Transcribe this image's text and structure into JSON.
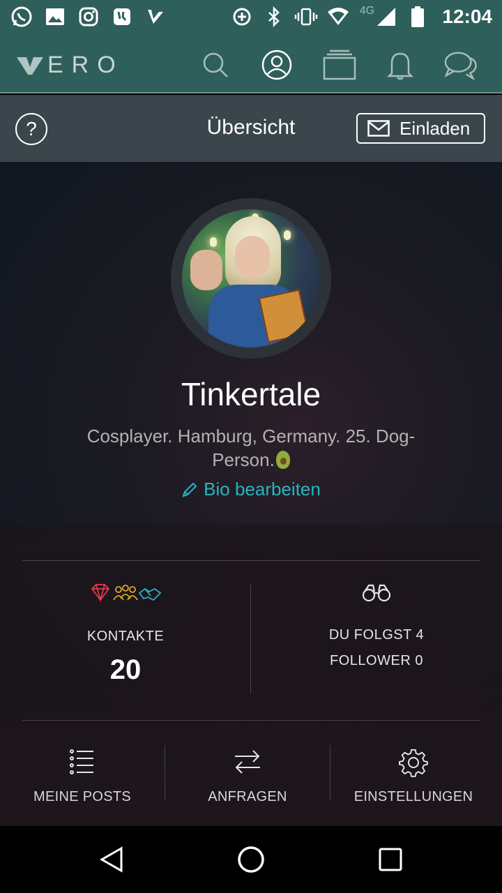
{
  "status_bar": {
    "time": "12:04",
    "network": "4G",
    "icons": [
      "whatsapp-icon",
      "gallery-icon",
      "instagram-icon",
      "tinder-like-icon",
      "check-icon",
      "data-saver-icon",
      "bluetooth-icon",
      "vibrate-icon",
      "wifi-icon",
      "signal-icon",
      "battery-icon"
    ]
  },
  "nav": {
    "logo": "ERO",
    "icons": [
      "search-icon",
      "profile-icon",
      "collections-icon",
      "notifications-icon",
      "chat-icon"
    ],
    "active": "profile-icon"
  },
  "header": {
    "title": "Übersicht",
    "help_label": "?",
    "invite_label": "Einladen"
  },
  "profile": {
    "name": "Tinkertale",
    "bio_line1": "Cosplayer. Hamburg, Germany. 25. Dog-",
    "bio_line2": "Person.",
    "edit_bio": "Bio bearbeiten"
  },
  "stats": {
    "contacts_label": "KONTAKTE",
    "contacts_value": "20",
    "following_label": "DU FOLGST 4",
    "followers_label": "FOLLOWER 0"
  },
  "bottom": {
    "posts": "MEINE POSTS",
    "requests": "ANFRAGEN",
    "settings": "EINSTELLUNGEN"
  },
  "colors": {
    "teal_bar": "#2f5f5a",
    "header_bg": "#3a464c",
    "accent": "#2bb3c0"
  }
}
